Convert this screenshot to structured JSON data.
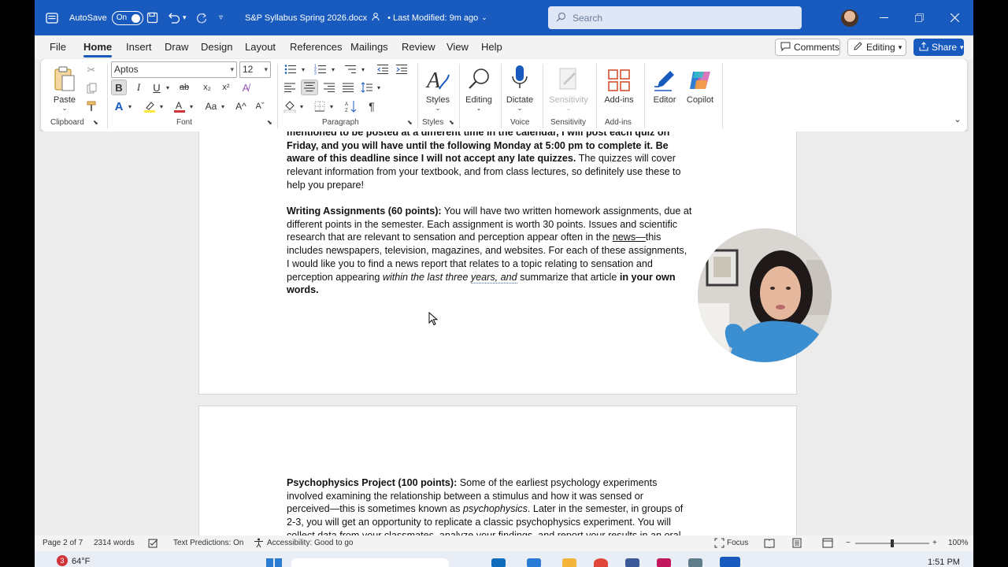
{
  "titlebar": {
    "autosave_label": "AutoSave",
    "autosave_state": "On",
    "doc_title": "S&P Syllabus Spring 2026.docx",
    "last_modified": "• Last Modified: 9m ago",
    "search_placeholder": "Search",
    "accent_color": "#185abd"
  },
  "menu": {
    "items": [
      "File",
      "Home",
      "Insert",
      "Draw",
      "Design",
      "Layout",
      "References",
      "Mailings",
      "Review",
      "View",
      "Help"
    ],
    "active": "Home",
    "comments": "Comments",
    "editing": "Editing",
    "share": "Share"
  },
  "ribbon": {
    "clipboard": {
      "paste": "Paste",
      "label": "Clipboard"
    },
    "font": {
      "name": "Aptos",
      "size": "12",
      "label": "Font"
    },
    "paragraph": {
      "label": "Paragraph"
    },
    "styles": {
      "button": "Styles",
      "label": "Styles"
    },
    "editing": {
      "button": "Editing"
    },
    "voice": {
      "button": "Dictate",
      "label": "Voice"
    },
    "sensitivity": {
      "button": "Sensitivity",
      "label": "Sensitivity"
    },
    "addins": {
      "button": "Add-ins",
      "label": "Add-ins"
    },
    "editor": {
      "button": "Editor"
    },
    "copilot": {
      "button": "Copilot"
    }
  },
  "document": {
    "page1": {
      "p1_l1": "mentioned to be posted at a different time in the calendar, I will post each quiz on",
      "p1_l2": "Friday, and you will have until the following Monday at 5:00 pm to complete it. Be",
      "p1_l3_bold": "aware of this deadline since I will not accept any late quizzes.",
      "p1_l3_rest": "  The quizzes will cover",
      "p1_l4": "relevant information from your textbook, and from class lectures, so definitely use these to",
      "p1_l5": "help you prepare!",
      "p2_heading": "Writing Assignments (60 points):",
      "p2_l1_rest": " You will have two written homework assignments, due at",
      "p2_l2": "different points in the semester. Each assignment is worth 30 points. Issues and scientific",
      "p2_l3_a": "research that are relevant to sensation and perception appear often in the ",
      "p2_l3_news": "news—",
      "p2_l3_b": "this",
      "p2_l4": "includes newspapers, television, magazines, and websites. For each of these assignments,",
      "p2_l5": "I would like you to find a news report that relates to a topic relating to sensation and",
      "p2_l6_a": "perception appearing ",
      "p2_l6_i1": "within the last three ",
      "p2_l6_i2": "years, and",
      "p2_l6_b": " summarize that article ",
      "p2_l6_bold": "in your own",
      "p2_l7_bold": "words."
    },
    "page2": {
      "p3_heading": "Psychophysics Project (100 points):",
      "p3_l1_rest": " Some of the earliest psychology experiments",
      "p3_l2": "involved examining the relationship between a stimulus and how it was sensed or",
      "p3_l3_a": "perceived—this is sometimes known as ",
      "p3_l3_i": "psychophysics",
      "p3_l3_b": ". Later in the semester, in groups of",
      "p3_l4": "2-3, you will get an opportunity to replicate a classic psychophysics experiment. You will",
      "p3_l5": "collect data from your classmates, analyze your findings, and report your results in an oral"
    }
  },
  "statusbar": {
    "page": "Page 2 of 7",
    "words": "2314 words",
    "text_predictions": "Text Predictions: On",
    "accessibility": "Accessibility: Good to go",
    "focus": "Focus",
    "zoom": "100%"
  },
  "taskbar": {
    "weather_badge": "3",
    "weather": "64°F",
    "time": "1:51 PM"
  }
}
